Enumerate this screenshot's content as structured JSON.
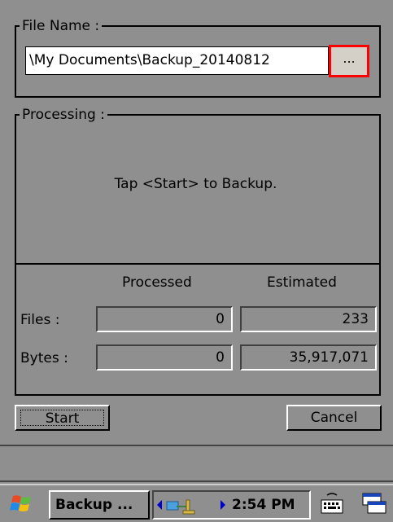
{
  "file_group": {
    "title": "File Name :",
    "path_value": "\\My Documents\\Backup_20140812",
    "browse_label": "..."
  },
  "processing_group": {
    "title": "Processing :",
    "message": "Tap <Start> to Backup.",
    "col_processed": "Processed",
    "col_estimated": "Estimated",
    "rows": [
      {
        "label": "Files :",
        "processed": "0",
        "estimated": "233"
      },
      {
        "label": "Bytes :",
        "processed": "0",
        "estimated": "35,917,071"
      }
    ]
  },
  "buttons": {
    "start": "Start",
    "cancel": "Cancel"
  },
  "taskbar": {
    "task_label": "Backup ...",
    "clock": "2:54 PM",
    "icons": [
      "windows-flag-icon",
      "network-icon",
      "keyboard-icon",
      "switch-window-icon"
    ]
  },
  "colors": {
    "highlight": "#ff0000",
    "background": "#8f8f8f"
  }
}
